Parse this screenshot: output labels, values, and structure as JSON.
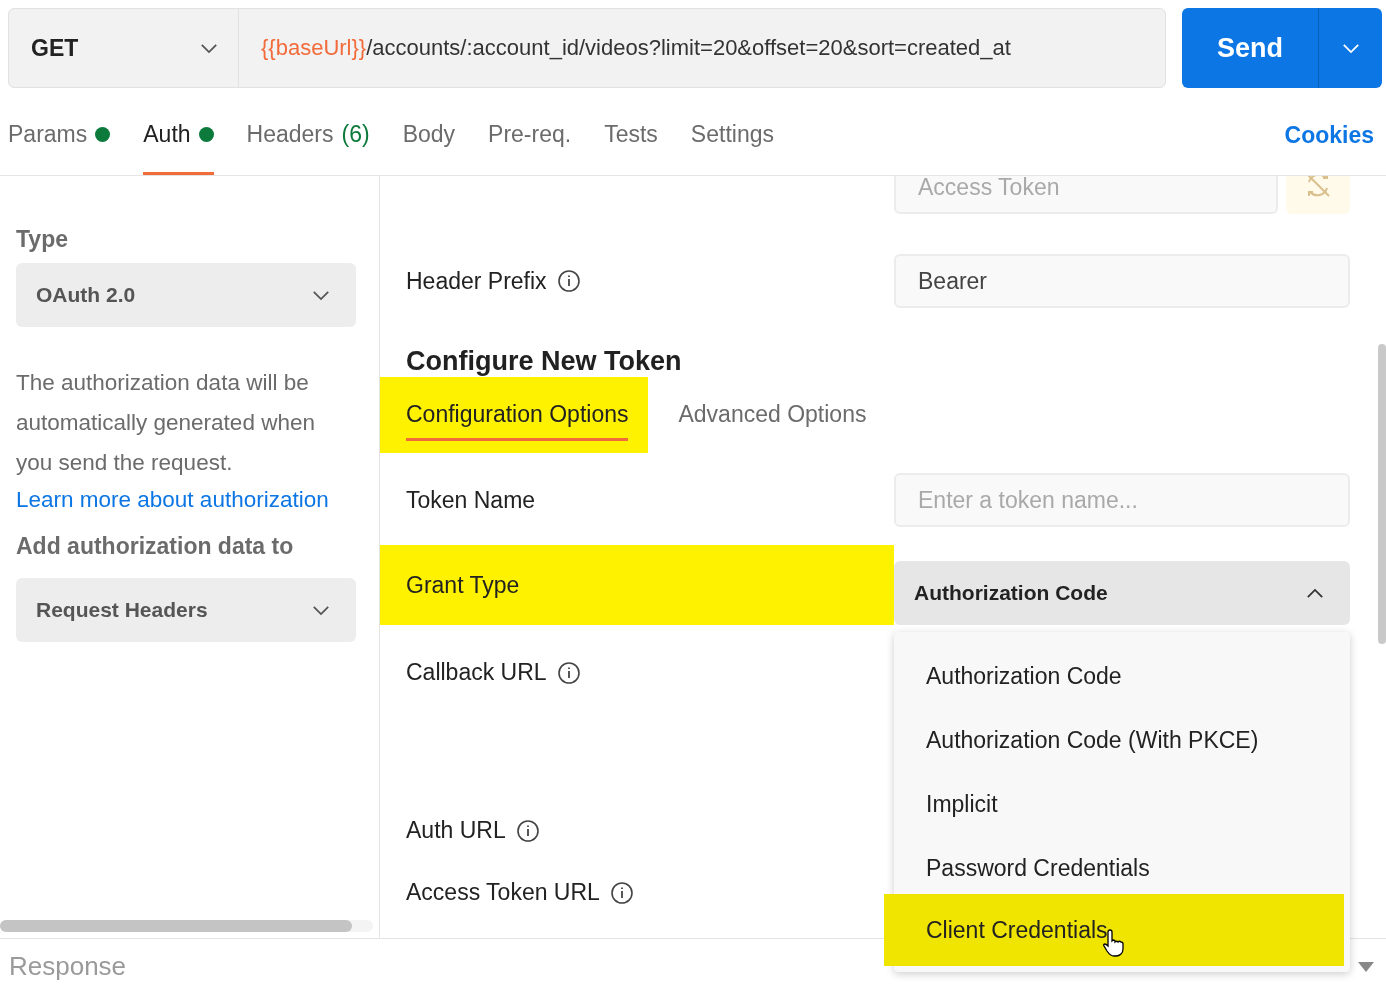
{
  "request": {
    "method": "GET",
    "url_variable": "{{baseUrl}}",
    "url_path": "/accounts/:account_id/videos?limit=20&offset=20&sort=created_at",
    "send_label": "Send"
  },
  "tabs": [
    {
      "label": "Params",
      "indicator": true,
      "selected": false
    },
    {
      "label": "Auth",
      "indicator": true,
      "selected": true
    },
    {
      "label": "Headers",
      "count": "(6)",
      "indicator": false,
      "selected": false
    },
    {
      "label": "Body",
      "indicator": false,
      "selected": false
    },
    {
      "label": "Pre-req.",
      "indicator": false,
      "selected": false
    },
    {
      "label": "Tests",
      "indicator": false,
      "selected": false
    },
    {
      "label": "Settings",
      "indicator": false,
      "selected": false
    }
  ],
  "cookies": "Cookies",
  "sidebar": {
    "type_label": "Type",
    "type_value": "OAuth 2.0",
    "description": "The authorization data will be automatically generated when you send the request.",
    "link": "Learn more about authorization",
    "add_to_label": "Add authorization data to",
    "add_to_value": "Request Headers"
  },
  "form": {
    "access_token_placeholder": "Access Token",
    "header_prefix": {
      "label": "Header Prefix",
      "value": "Bearer"
    },
    "section_title": "Configure New Token",
    "subtabs": [
      {
        "label": "Configuration Options",
        "selected": true,
        "highlighted": true
      },
      {
        "label": "Advanced Options",
        "selected": false,
        "highlighted": false
      }
    ],
    "fields": [
      {
        "label": "Token Name",
        "kind": "input",
        "placeholder": "Enter a token name...",
        "info": false,
        "highlighted": false
      },
      {
        "label": "Grant Type",
        "kind": "select",
        "value": "Authorization Code",
        "expanded": true,
        "info": false,
        "highlighted": true
      },
      {
        "label": "Callback URL",
        "kind": "covered",
        "info": true,
        "highlighted": false
      },
      {
        "label": "Auth URL",
        "kind": "covered",
        "info": true,
        "highlighted": false
      },
      {
        "label": "Access Token URL",
        "kind": "covered",
        "info": true,
        "highlighted": false
      }
    ],
    "grant_options": [
      {
        "label": "Authorization Code",
        "highlighted": false
      },
      {
        "label": "Authorization Code (With PKCE)",
        "highlighted": false
      },
      {
        "label": "Implicit",
        "highlighted": false
      },
      {
        "label": "Password Credentials",
        "highlighted": false
      },
      {
        "label": "Client Credentials",
        "highlighted": true
      }
    ]
  },
  "response": {
    "label": "Response"
  }
}
